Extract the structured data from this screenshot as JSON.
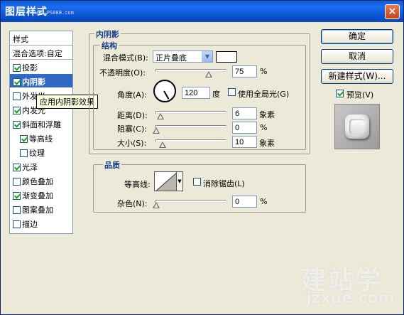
{
  "title": {
    "text": "图层样式",
    "watermark": "www.PS888.com",
    "close_glyph": "×"
  },
  "stylelist": {
    "header": "样式",
    "blend": "混合选项:自定",
    "items": [
      {
        "label": "投影",
        "checked": true
      },
      {
        "label": "内阴影",
        "checked": true,
        "selected": true
      },
      {
        "label": "外发光",
        "checked": false
      },
      {
        "label": "内发光",
        "checked": true
      },
      {
        "label": "斜面和浮雕",
        "checked": true
      },
      {
        "label": "等高线",
        "checked": true,
        "sub": true
      },
      {
        "label": "纹理",
        "checked": false,
        "sub": true
      },
      {
        "label": "光泽",
        "checked": true
      },
      {
        "label": "颜色叠加",
        "checked": false
      },
      {
        "label": "渐变叠加",
        "checked": true
      },
      {
        "label": "图案叠加",
        "checked": false
      },
      {
        "label": "描边",
        "checked": false
      }
    ],
    "tooltip": "应用内阴影效果"
  },
  "inner_shadow": {
    "title": "内阴影",
    "structure": {
      "title": "结构",
      "blend_mode_label": "混合模式(B):",
      "blend_mode_value": "正片叠底",
      "opacity_label": "不透明度(O):",
      "opacity_value": "75",
      "opacity_unit": "%",
      "opacity_level": 0.75,
      "angle_label": "角度(A):",
      "angle_value": "120",
      "angle_unit": "度",
      "global_light_label": "使用全局光(G)",
      "global_light_checked": false,
      "distance_label": "距离(D):",
      "distance_value": "6",
      "distance_unit": "象素",
      "choke_label": "阻塞(C):",
      "choke_value": "0",
      "choke_unit": "%",
      "size_label": "大小(S):",
      "size_value": "10",
      "size_unit": "象素"
    },
    "quality": {
      "title": "品质",
      "contour_label": "等高线:",
      "antialias_label": "消除锯齿(L)",
      "antialias_checked": false,
      "noise_label": "杂色(N):",
      "noise_value": "0",
      "noise_unit": "%"
    }
  },
  "buttons": {
    "ok": "确定",
    "cancel": "取消",
    "new_style": "新建样式(W)...",
    "preview_label": "预览(V)",
    "preview_checked": true
  },
  "watermark": {
    "brand": "建站学",
    "url": "jzxue.com"
  }
}
